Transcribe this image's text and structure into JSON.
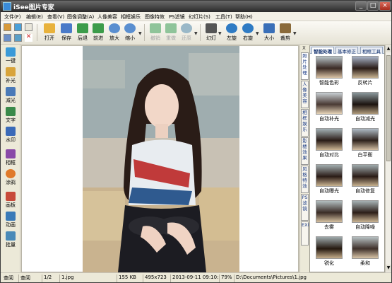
{
  "title": "iSee图片专家",
  "menu": [
    "文件(F)",
    "编辑(E)",
    "查看(V)",
    "图像调整(A)",
    "人像美容",
    "相框娱乐",
    "图像特效",
    "PS滤镜",
    "幻灯片(S)",
    "工具(T)",
    "帮助(H)"
  ],
  "toolbar": {
    "buttons": [
      {
        "label": "打开",
        "icon": "open-folder-icon",
        "color": "#e8b23c"
      },
      {
        "label": "保存",
        "icon": "save-icon",
        "color": "#4a7ac8"
      },
      {
        "label": "后退",
        "icon": "back-icon",
        "color": "#3c9c4a"
      },
      {
        "label": "前进",
        "icon": "forward-icon",
        "color": "#3c9c4a"
      },
      {
        "label": "放大",
        "icon": "zoom-in-icon",
        "color": "#5a8fd0"
      },
      {
        "label": "缩小",
        "icon": "zoom-out-icon",
        "color": "#5a8fd0"
      },
      {
        "label": "撤销",
        "icon": "undo-icon",
        "color": "#8fc49a",
        "disabled": true
      },
      {
        "label": "重做",
        "icon": "redo-icon",
        "color": "#8fc49a",
        "disabled": true
      },
      {
        "label": "还原",
        "icon": "restore-icon",
        "color": "#9ab8c8",
        "disabled": true
      },
      {
        "label": "幻灯",
        "icon": "slideshow-icon",
        "color": "#555555"
      },
      {
        "label": "左旋",
        "icon": "rotate-left-icon",
        "color": "#2f7bc4"
      },
      {
        "label": "右旋",
        "icon": "rotate-right-icon",
        "color": "#2f7bc4"
      },
      {
        "label": "大小",
        "icon": "resize-icon",
        "color": "#3a6fb8"
      },
      {
        "label": "裁剪",
        "icon": "crop-icon",
        "color": "#8a6a3a"
      }
    ]
  },
  "left_tools": [
    {
      "label": "一键",
      "icon": "one-click-icon",
      "color": "#3a9ad8"
    },
    {
      "label": "补光",
      "icon": "fill-light-icon",
      "color": "#d8a43a"
    },
    {
      "label": "减光",
      "icon": "reduce-light-icon",
      "color": "#4a7ab8"
    },
    {
      "label": "文字",
      "icon": "text-icon",
      "color": "#3a8a4a"
    },
    {
      "label": "水印",
      "icon": "watermark-icon",
      "color": "#3a6ab8"
    },
    {
      "label": "相框",
      "icon": "frame-icon",
      "color": "#8a4aa8"
    },
    {
      "label": "涂鸦",
      "icon": "doodle-icon",
      "color": "#e07a2a"
    },
    {
      "label": "画板",
      "icon": "drawing-board-icon",
      "color": "#c84a3a"
    },
    {
      "label": "动画",
      "icon": "animation-icon",
      "color": "#3a7ab8"
    },
    {
      "label": "批量",
      "icon": "batch-icon",
      "color": "#4a8ab8"
    }
  ],
  "vtabs": [
    "照片处理",
    "人像美容",
    "相框娱乐",
    "影楼效果",
    "风格特效",
    "PS滤镜",
    "EXIF"
  ],
  "vtab_close": "X",
  "right_panel": {
    "tabs": [
      "智能处理",
      "基本修正",
      "相框工具"
    ],
    "thumbnails": [
      "智能色彩",
      "反转片",
      "自动补光",
      "自动减光",
      "自动对比",
      "白平衡",
      "自动曝光",
      "自动修复",
      "去雾",
      "自动降噪",
      "锐化",
      "柔和"
    ]
  },
  "statusbar": [
    "查阅",
    "查阅",
    "1/2",
    "1.jpg",
    "155 KB",
    "495x723",
    "2013-09-11 09:10:08",
    "79%",
    "D:\\Documents\\Pictures\\1.jpg"
  ],
  "photo": {
    "description_icon": "portrait-photo"
  }
}
